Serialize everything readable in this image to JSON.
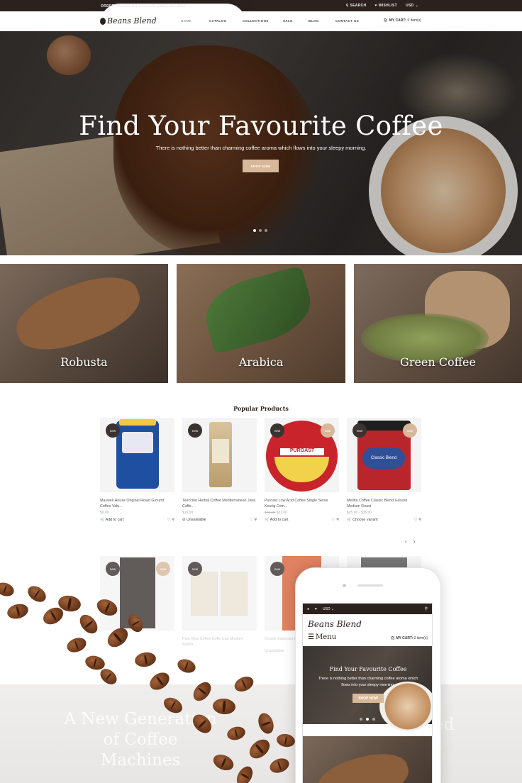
{
  "topbar": {
    "phone": "ORDER ONLINE OR CALL US (1800) 000 8808",
    "search": "SEARCH",
    "wishlist": "WISHLIST",
    "currency": "USD"
  },
  "header": {
    "logo": "Beans Blend",
    "nav": [
      "HOME",
      "CATALOG",
      "COLLECTIONS",
      "SALE",
      "BLOG",
      "CONTACT US"
    ],
    "cart_label": "MY CART:",
    "cart_count": "0 item(s)"
  },
  "hero": {
    "title": "Find Your Favourite Coffee",
    "subtitle": "There is nothing better than charming coffee aroma which flows into your sleepy morning.",
    "button": "SHOP NOW",
    "slides": 3,
    "active_slide": 1
  },
  "categories": [
    {
      "label": "Robusta"
    },
    {
      "label": "Arabica"
    },
    {
      "label": "Green Coffee"
    }
  ],
  "popular": {
    "title": "Popular Products",
    "products": [
      {
        "name": "Maxwell House Original Roast Ground Coffee Valu...",
        "price": "$9.00",
        "old_price": "",
        "badge_new": "new",
        "badge_sale": "",
        "action": "Add to cart",
        "action_icon": "cart-icon"
      },
      {
        "name": "Teeccino Herbal Coffee Mediterranean Java Caffe...",
        "price": "$16.00",
        "old_price": "",
        "badge_new": "new",
        "badge_sale": "",
        "action": "Unavailable",
        "action_icon": "blocked-icon"
      },
      {
        "name": "Puroast Low Acid Coffee Single Serve Keurig Com...",
        "price": "$31.00",
        "old_price": "$45.00",
        "badge_new": "new",
        "badge_sale": "sale",
        "action": "Add to cart",
        "action_icon": "cart-icon"
      },
      {
        "name": "Melitta Coffee Classic Blend Ground Medium Roast",
        "price": "$25.00 - $36.00",
        "old_price": "",
        "badge_new": "new",
        "badge_sale": "sale",
        "action": "Choose variant",
        "action_icon": "cart-icon"
      }
    ],
    "row2": [
      {
        "name": "",
        "badge_new": "new",
        "badge_sale": "sale"
      },
      {
        "name": "Pure Blue Coffee Coffe Cup Monkey Bunch...",
        "badge_new": "new",
        "badge_sale": ""
      },
      {
        "name": "Double Espresso Brown Coffee Ground...",
        "badge_new": "new",
        "badge_sale": "",
        "action": "Unavailable"
      },
      {
        "name": "",
        "badge_new": "",
        "badge_sale": ""
      }
    ]
  },
  "banner": {
    "title": "A New Generation of Coffee Machines",
    "right_fragment": "ed\ns"
  },
  "mobile": {
    "currency": "USD",
    "logo": "Beans Blend",
    "menu": "Menu",
    "cart_label": "MY CART:",
    "cart_count": "0 item(s)",
    "hero_title": "Find Your Favourite Coffee",
    "hero_subtitle": "There is nothing better than charming coffee aroma which flows into your sleepy morning.",
    "hero_button": "SHOP NOW"
  },
  "colors": {
    "dark": "#2b2220",
    "accent": "#d7b89a",
    "badge_new": "#3b3330"
  }
}
